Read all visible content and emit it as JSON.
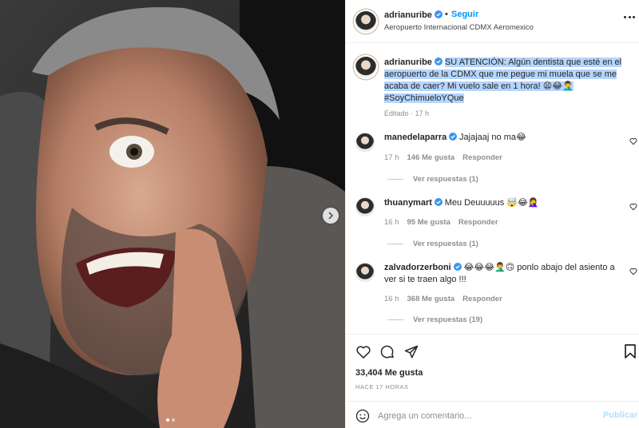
{
  "post": {
    "username": "adrianuribe",
    "follow_label": "Seguir",
    "follow_separator": "•",
    "location": "Aeropuerto Internacional CDMX Aeromexico",
    "caption_user": "adrianuribe",
    "caption_text": "SU ATENCIÓN: Algún dentista que esté en el aeropuerto de la CDMX que me pegue mi muela que se me acaba de caer? Mi vuelo sale en 1 hora! 😩😂🤦‍♂️",
    "caption_hashtag": "#SoyChimueloYQue",
    "edited_label": "Editado",
    "caption_time": "17 h",
    "meta_separator": "·"
  },
  "comments": [
    {
      "username": "manedelaparra",
      "text": "Jajajaaj no ma😂",
      "time": "17 h",
      "likes": "146 Me gusta",
      "reply": "Responder",
      "view_replies": "Ver respuestas (1)"
    },
    {
      "username": "thuanymart",
      "text": "Meu Deuuuuus 🤯😂🤦‍♀️",
      "time": "16 h",
      "likes": "95 Me gusta",
      "reply": "Responder",
      "view_replies": "Ver respuestas (1)"
    },
    {
      "username": "zalvadorzerboni",
      "text": "😂😂😂🤦‍♂️🙃 ponlo abajo del asiento a ver si te traen algo !!!",
      "time": "16 h",
      "likes": "368 Me gusta",
      "reply": "Responder",
      "view_replies": "Ver respuestas (19)"
    }
  ],
  "footer": {
    "likes": "33,404 Me gusta",
    "ago": "HACE 17 HORAS",
    "comment_placeholder": "Agrega un comentario...",
    "publish_label": "Publicar"
  },
  "carousel": {
    "total_slides": 2,
    "active_slide": 1
  },
  "colors": {
    "accent": "#0095f6",
    "verified": "#3897f0",
    "muted": "#8e8e8e",
    "highlight": "#b4d5fe"
  },
  "icons": [
    "chevron-right-icon",
    "verified-badge-icon",
    "more-options-icon",
    "heart-icon",
    "comment-icon",
    "share-icon",
    "bookmark-icon",
    "emoji-icon"
  ]
}
